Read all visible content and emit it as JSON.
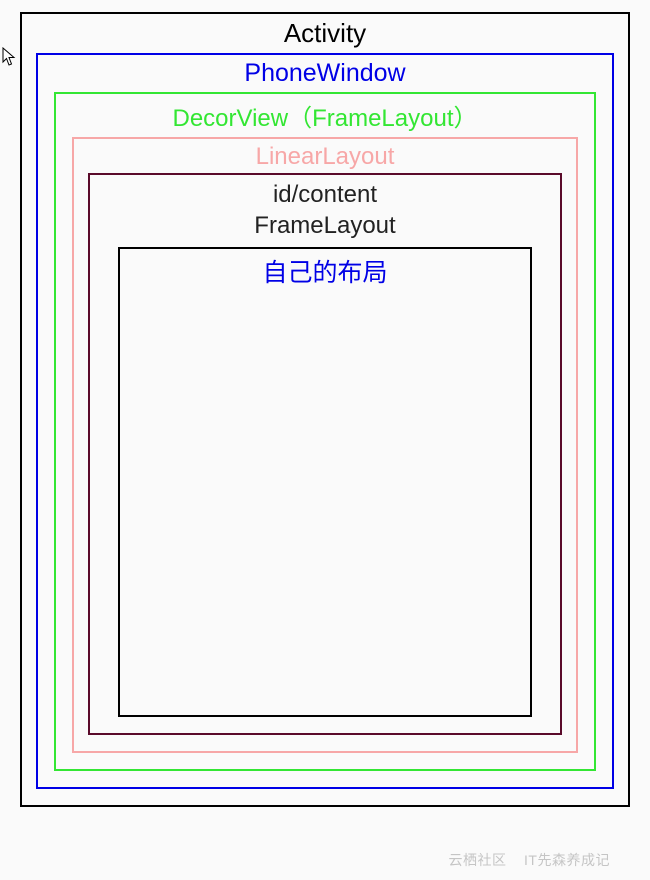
{
  "boxes": {
    "activity": {
      "label": "Activity",
      "borderColor": "#000",
      "textColor": "#000"
    },
    "phonewindow": {
      "label": "PhoneWindow",
      "borderColor": "#0000e6",
      "textColor": "#0000e6"
    },
    "decorview": {
      "label": "DecorView（FrameLayout）",
      "borderColor": "#33e633",
      "textColor": "#33e633"
    },
    "linearlayout": {
      "label": "LinearLayout",
      "borderColor": "#f7a7a7",
      "textColor": "#f7a7a7"
    },
    "content": {
      "label_line1": "id/content",
      "label_line2": "FrameLayout",
      "borderColor": "#5a0a2a",
      "textColor": "#222"
    },
    "ownlayout": {
      "label": "自己的布局",
      "borderColor": "#000",
      "textColor": "#0000e6"
    }
  },
  "watermark": {
    "left": "云栖社区",
    "right": "IT先森养成记"
  }
}
